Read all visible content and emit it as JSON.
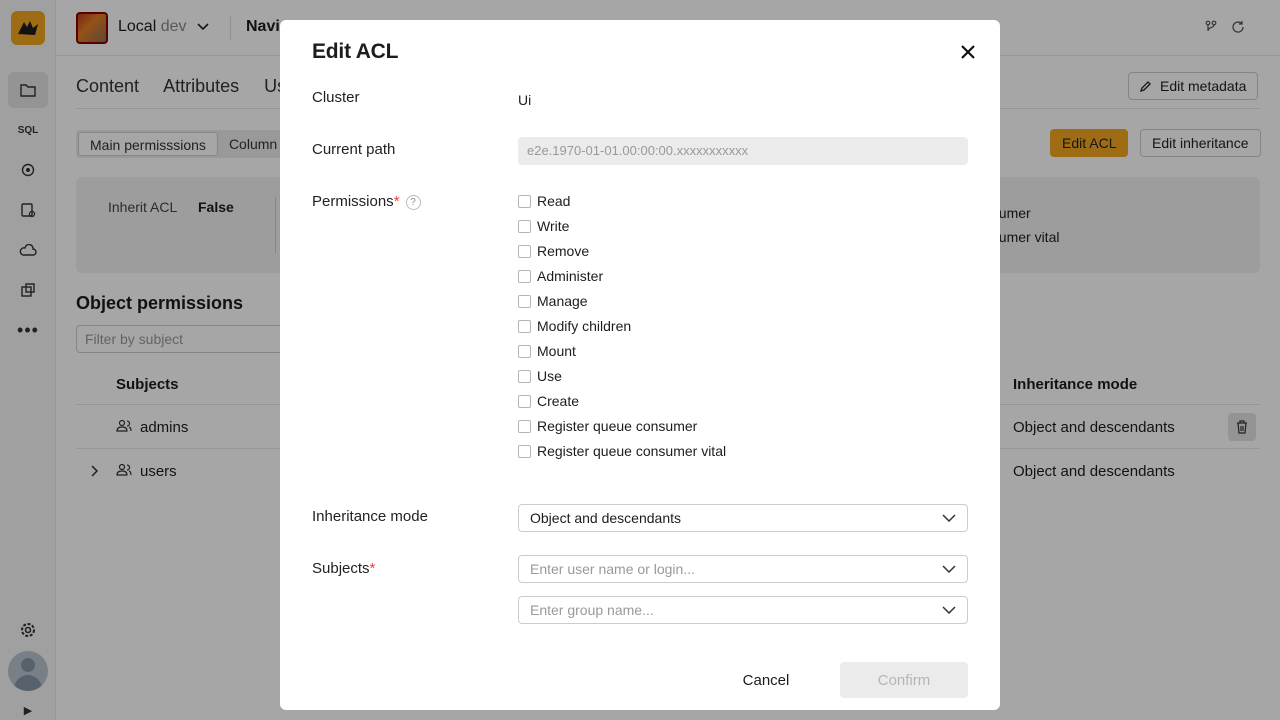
{
  "app": {
    "cluster_name": "Local",
    "cluster_env": "dev",
    "navigation_title": "Navi"
  },
  "background": {
    "tabs": [
      "Content",
      "Attributes",
      "Use"
    ],
    "edit_metadata_label": "Edit metadata",
    "subtabs": [
      "Main permisssions",
      "Column"
    ],
    "edit_acl_label": "Edit ACL",
    "edit_inheritance_label": "Edit inheritance",
    "inherit_acl_label": "Inherit ACL",
    "inherit_acl_value": "False",
    "side_list": [
      "nsumer",
      "nsumer vital"
    ],
    "object_permissions_title": "Object permissions",
    "filter_placeholder": "Filter by subject",
    "columns": {
      "subjects": "Subjects",
      "inheritance_mode": "Inheritance mode"
    },
    "rows": [
      {
        "subject": "admins",
        "inheritance_mode": "Object and descendants"
      },
      {
        "subject": "users",
        "inheritance_mode": "Object and descendants"
      }
    ]
  },
  "modal": {
    "title": "Edit ACL",
    "cluster_label": "Cluster",
    "cluster_value": "Ui",
    "current_path_label": "Current path",
    "current_path_value": "e2e.1970-01-01.00:00:00.xxxxxxxxxxx",
    "permissions_label": "Permissions",
    "help_glyph": "?",
    "permissions": [
      "Read",
      "Write",
      "Remove",
      "Administer",
      "Manage",
      "Modify children",
      "Mount",
      "Use",
      "Create",
      "Register queue consumer",
      "Register queue consumer vital"
    ],
    "inheritance_mode_label": "Inheritance mode",
    "inheritance_mode_value": "Object and descendants",
    "subjects_label": "Subjects",
    "user_placeholder": "Enter user name or login...",
    "group_placeholder": "Enter group name...",
    "cancel_label": "Cancel",
    "confirm_label": "Confirm",
    "required_mark": "*"
  }
}
